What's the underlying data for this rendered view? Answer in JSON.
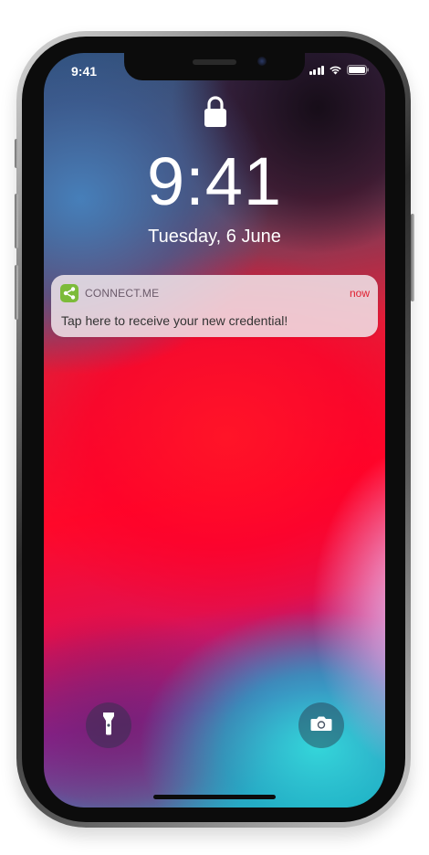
{
  "status_bar": {
    "time": "9:41",
    "icons": [
      "signal-icon",
      "wifi-icon",
      "battery-icon"
    ]
  },
  "lock_screen": {
    "lock_icon": "lock-icon",
    "time": "9:41",
    "date": "Tuesday, 6 June"
  },
  "notification": {
    "app_name": "CONNECT.ME",
    "time_ago": "now",
    "message": "Tap here to receive your new credential!",
    "app_icon": "share-icon",
    "app_icon_color": "#7cbb3a",
    "time_ago_color": "#e02030"
  },
  "bottom_controls": {
    "left_icon": "flashlight-icon",
    "right_icon": "camera-icon"
  }
}
